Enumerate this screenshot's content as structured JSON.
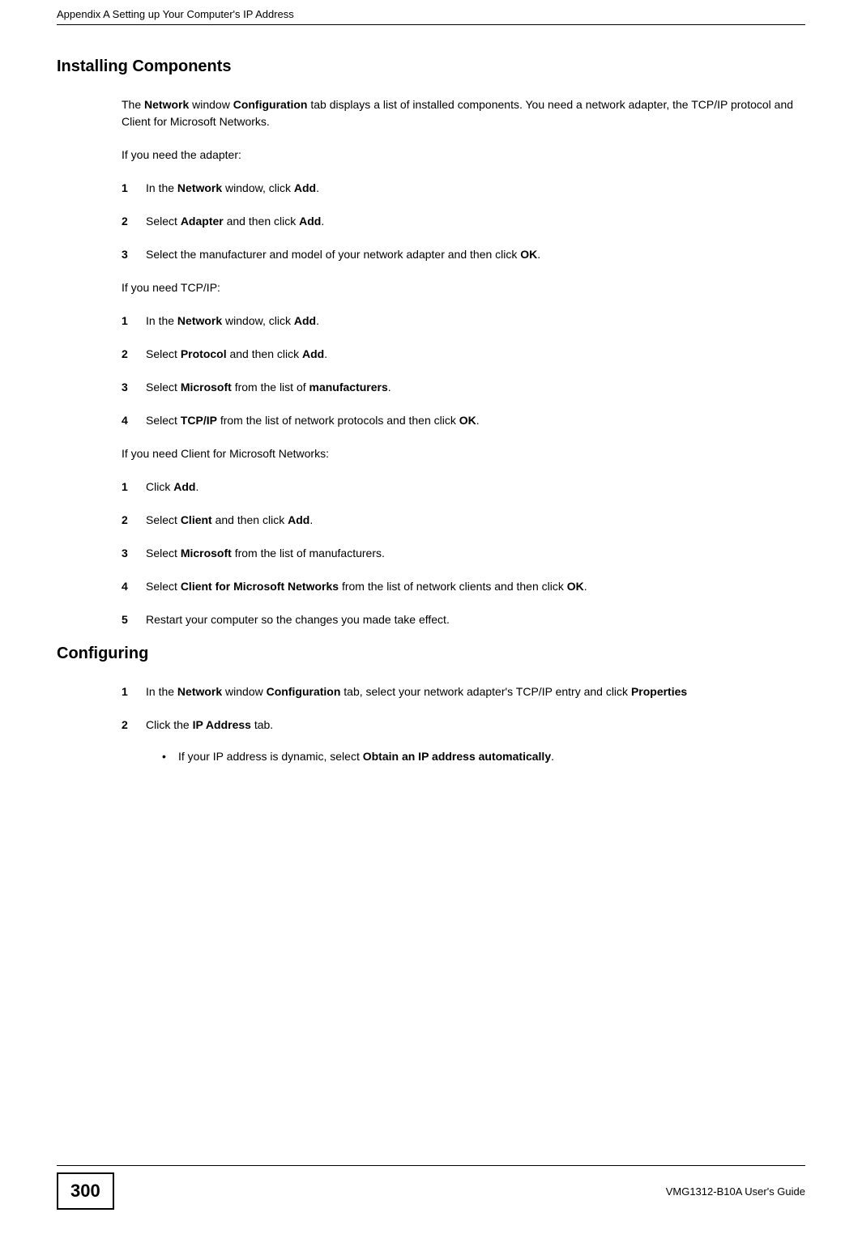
{
  "header": {
    "text": "Appendix A Setting up Your Computer's IP Address"
  },
  "sections": {
    "installing": {
      "heading": "Installing Components",
      "intro": "The Network window Configuration tab displays a list of installed components. You need a network adapter, the TCP/IP protocol and Client for Microsoft Networks.",
      "intro_word1": "Network",
      "intro_word2": "Configuration",
      "if_adapter": "If you need the adapter:",
      "adapter_steps": {
        "s1": {
          "num": "1",
          "pre": "In the ",
          "b1": "Network",
          "mid": " window, click ",
          "b2": "Add",
          "post": "."
        },
        "s2": {
          "num": "2",
          "pre": "Select ",
          "b1": "Adapter",
          "mid": " and then click ",
          "b2": "Add",
          "post": "."
        },
        "s3": {
          "num": "3",
          "pre": "Select the manufacturer and model of your network adapter and then click ",
          "b1": "OK",
          "post": "."
        }
      },
      "if_tcpip": "If you need TCP/IP:",
      "tcpip_steps": {
        "s1": {
          "num": "1",
          "pre": "In the ",
          "b1": "Network",
          "mid": " window, click ",
          "b2": "Add",
          "post": "."
        },
        "s2": {
          "num": "2",
          "pre": "Select ",
          "b1": "Protocol",
          "mid": " and then click ",
          "b2": "Add",
          "post": "."
        },
        "s3": {
          "num": "3",
          "pre": "Select ",
          "b1": "Microsoft",
          "mid": " from the list of ",
          "b2": "manufacturers",
          "post": "."
        },
        "s4": {
          "num": "4",
          "pre": "Select ",
          "b1": "TCP/IP",
          "mid": " from the list of network protocols and then click ",
          "b2": "OK",
          "post": "."
        }
      },
      "if_client": "If you need Client for Microsoft Networks:",
      "client_steps": {
        "s1": {
          "num": "1",
          "pre": "Click ",
          "b1": "Add",
          "post": "."
        },
        "s2": {
          "num": "2",
          "pre": "Select ",
          "b1": "Client",
          "mid": " and then click ",
          "b2": "Add",
          "post": "."
        },
        "s3": {
          "num": "3",
          "pre": "Select ",
          "b1": "Microsoft",
          "mid": " from the list of manufacturers.",
          "post": ""
        },
        "s4": {
          "num": "4",
          "pre": "Select ",
          "b1": "Client for Microsoft Networks",
          "mid": " from the list of network clients and then click ",
          "b2": "OK",
          "post": "."
        },
        "s5": {
          "num": "5",
          "text": "Restart your computer so the changes you made take effect."
        }
      }
    },
    "configuring": {
      "heading": "Configuring",
      "steps": {
        "s1": {
          "num": "1",
          "pre": "In the ",
          "b1": "Network",
          "mid": " window ",
          "b2": "Configuration",
          "mid2": " tab, select your network adapter's TCP/IP entry and click ",
          "b3": "Properties"
        },
        "s2": {
          "num": "2",
          "pre": "Click the ",
          "b1": "IP Address",
          "post": " tab."
        }
      },
      "sub": {
        "bullet": "•",
        "pre": "If your IP address is dynamic, select ",
        "b1": "Obtain an IP address automatically",
        "post": "."
      }
    }
  },
  "footer": {
    "page": "300",
    "guide": "VMG1312-B10A User's Guide"
  }
}
